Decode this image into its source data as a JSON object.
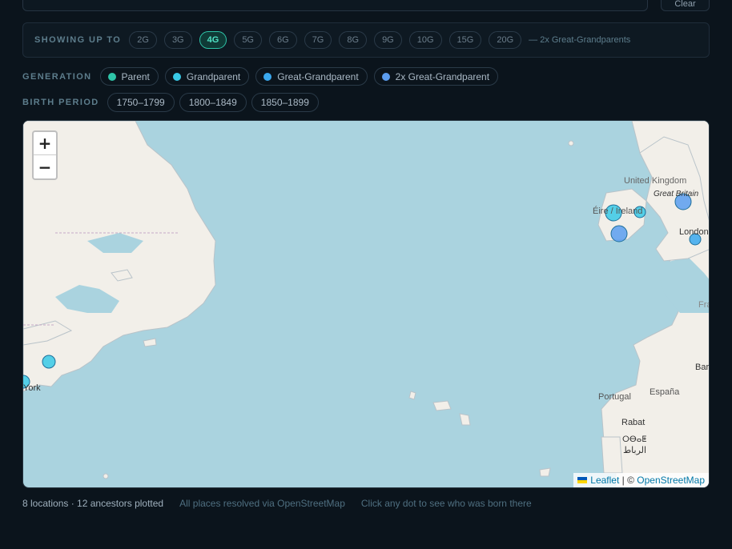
{
  "search": {
    "placeholder": "",
    "clear_label": "Clear"
  },
  "generation_filter": {
    "label": "SHOWING UP TO",
    "options": [
      "2G",
      "3G",
      "4G",
      "5G",
      "6G",
      "7G",
      "8G",
      "9G",
      "10G",
      "15G",
      "20G"
    ],
    "selected": "4G",
    "note": "— 2x Great-Grandparents"
  },
  "legend": {
    "label": "GENERATION",
    "items": [
      {
        "label": "Parent",
        "color": "#2ec4a8"
      },
      {
        "label": "Grandparent",
        "color": "#38c9e6"
      },
      {
        "label": "Great-Grandparent",
        "color": "#3aa8ee"
      },
      {
        "label": "2x Great-Grandparent",
        "color": "#5b9df0"
      }
    ]
  },
  "birth_period": {
    "label": "BIRTH PERIOD",
    "options": [
      "1750–1799",
      "1800–1849",
      "1850–1899"
    ]
  },
  "map": {
    "zoom_in": "+",
    "zoom_out": "−",
    "labels": {
      "uk": "United Kingdom",
      "gb": "Great Britain",
      "ireland": "Éire / Ireland",
      "london": "London",
      "portugal": "Portugal",
      "espana": "España",
      "rabat": "Rabat",
      "rabat_tifinagh": "ⵔⴱⴰⵟ",
      "rabat_arabic": "الرباط",
      "york": "York",
      "fr": "Fra",
      "bar": "Bar"
    },
    "attribution": {
      "leaflet": "Leaflet",
      "separator": " | © ",
      "osm": "OpenStreetMap"
    },
    "pins": [
      {
        "place": "Ireland west",
        "generation": "Grandparent"
      },
      {
        "place": "Dublin",
        "generation": "Grandparent"
      },
      {
        "place": "Cork",
        "generation": "2x Great-Grandparent"
      },
      {
        "place": "England north",
        "generation": "2x Great-Grandparent"
      },
      {
        "place": "London",
        "generation": "Great-Grandparent"
      },
      {
        "place": "Connecticut",
        "generation": "Grandparent"
      },
      {
        "place": "New York",
        "generation": "Grandparent"
      }
    ]
  },
  "footer": {
    "stats": "8 locations · 12 ancestors plotted",
    "resolved": "All places resolved via OpenStreetMap",
    "hint": "Click any dot to see who was born there"
  }
}
